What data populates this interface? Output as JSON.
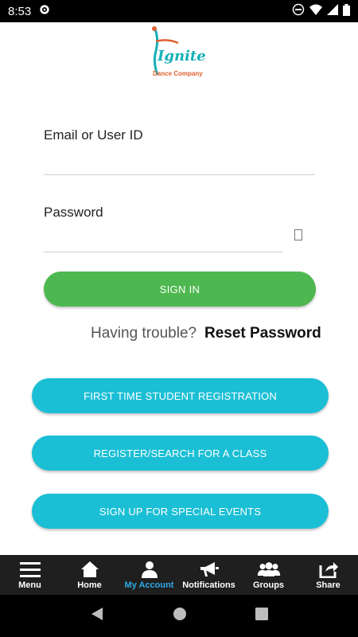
{
  "status_bar": {
    "time": "8:53"
  },
  "logo": {
    "word": "Ignite",
    "subtitle": "Dance Company"
  },
  "login": {
    "email_label": "Email or User ID",
    "email_value": "",
    "password_label": "Password",
    "password_value": "",
    "sign_in_label": "SIGN IN",
    "trouble_text": "Having trouble?",
    "reset_label": "Reset Password"
  },
  "actions": {
    "first_time": "FIRST TIME STUDENT REGISTRATION",
    "register": "REGISTER/SEARCH FOR A CLASS",
    "special": "SIGN UP FOR SPECIAL EVENTS"
  },
  "nav": {
    "menu": "Menu",
    "home": "Home",
    "account": "My Account",
    "notifications": "Notifications",
    "groups": "Groups",
    "share": "Share"
  },
  "colors": {
    "green": "#4db84f",
    "cyan": "#1bbfd5",
    "nav_active": "#2fa9e6",
    "nav_bg": "#1f1f1f"
  },
  "icons": [
    "settings-icon",
    "dnd-icon",
    "wifi-icon",
    "signal-icon",
    "battery-icon",
    "eye-icon",
    "menu-icon",
    "home-icon",
    "account-icon",
    "megaphone-icon",
    "groups-icon",
    "share-icon",
    "back-icon",
    "home-circle-icon",
    "recents-icon"
  ]
}
